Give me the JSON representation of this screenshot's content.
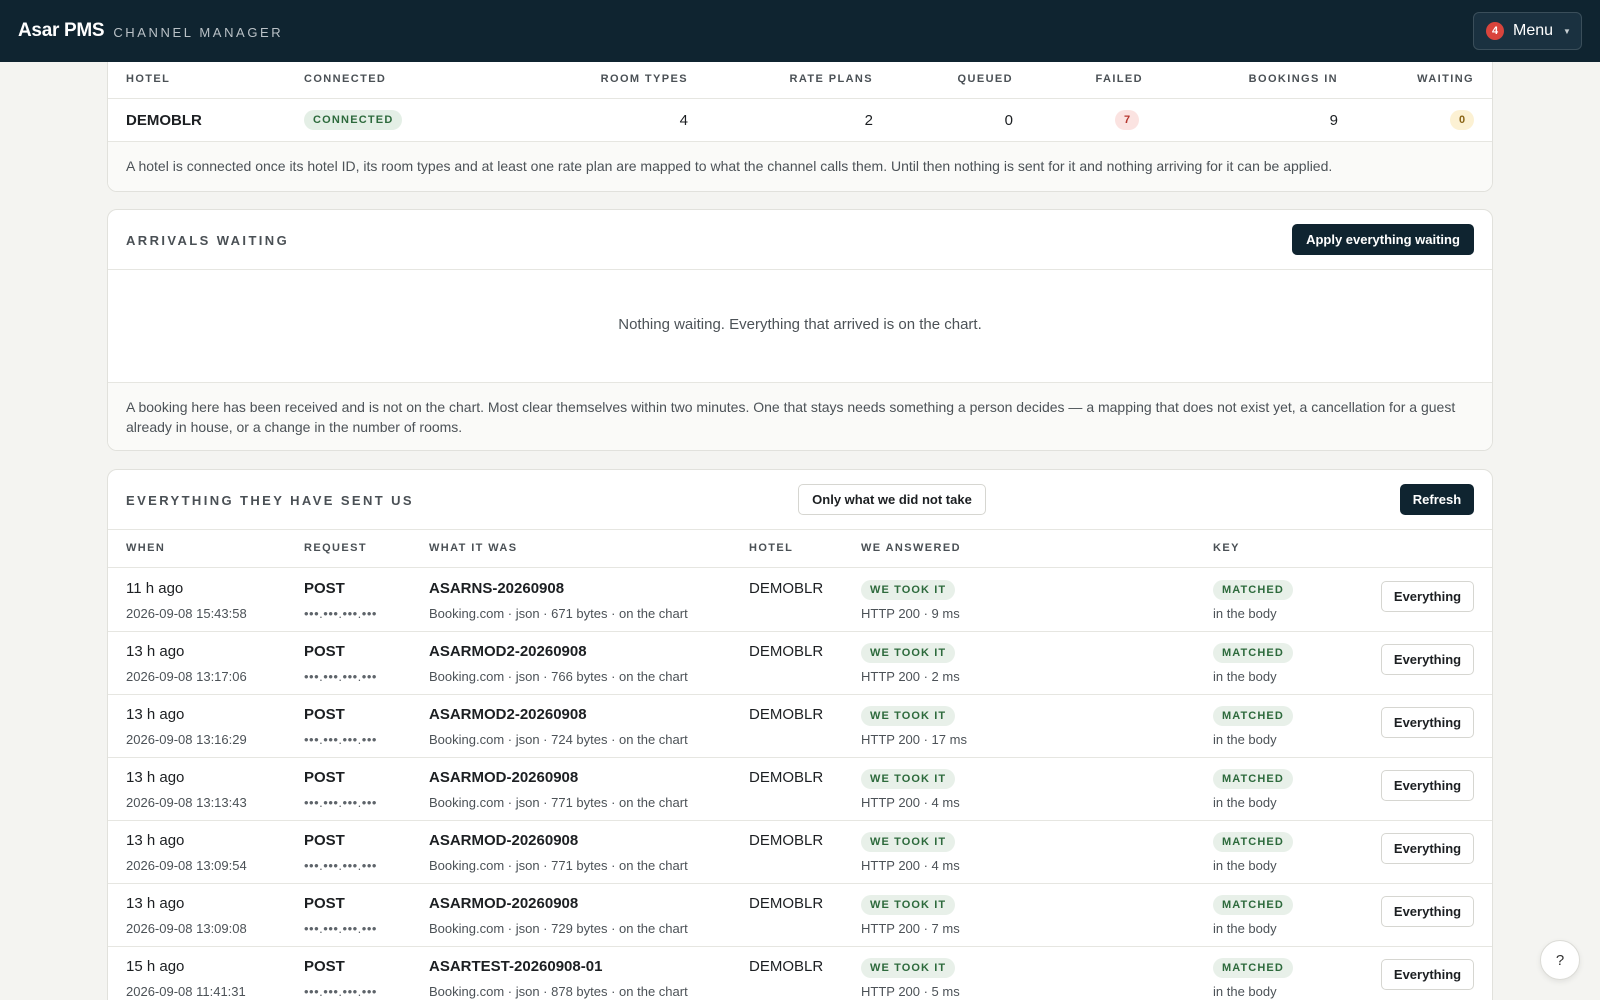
{
  "header": {
    "brand": "Asar PMS",
    "subtitle": "CHANNEL MANAGER",
    "menu_label": "Menu",
    "menu_badge": "4"
  },
  "hotels": {
    "columns": [
      "HOTEL",
      "CONNECTED",
      "ROOM TYPES",
      "RATE PLANS",
      "QUEUED",
      "FAILED",
      "BOOKINGS IN",
      "WAITING"
    ],
    "rows": [
      {
        "hotel": "DEMOBLR",
        "connected": "CONNECTED",
        "room_types": "4",
        "rate_plans": "2",
        "queued": "0",
        "failed": "7",
        "bookings_in": "9",
        "waiting": "0"
      }
    ],
    "note": "A hotel is connected once its hotel ID, its room types and at least one rate plan are mapped to what the channel calls them. Until then nothing is sent for it and nothing arriving for it can be applied."
  },
  "arrivals": {
    "title": "ARRIVALS WAITING",
    "apply_button": "Apply everything waiting",
    "empty": "Nothing waiting. Everything that arrived is on the chart.",
    "note": "A booking here has been received and is not on the chart. Most clear themselves within two minutes. One that stays needs something a person decides — a mapping that does not exist yet, a cancellation for a guest already in house, or a change in the number of rooms."
  },
  "log": {
    "title": "EVERYTHING THEY HAVE SENT US",
    "filter_button": "Only what we did not take",
    "refresh_button": "Refresh",
    "columns": [
      "WHEN",
      "REQUEST",
      "WHAT IT WAS",
      "HOTEL",
      "WE ANSWERED",
      "KEY"
    ],
    "rows": [
      {
        "ago": "11 h ago",
        "ts": "2026-09-08 15:43:58",
        "method": "POST",
        "ip": "•••.•••.•••.•••",
        "ref": "ASARNS-20260908",
        "detail": "Booking.com · json · 671 bytes · on the chart",
        "hotel": "DEMOBLR",
        "answer": "WE TOOK IT",
        "http": "HTTP 200 · 9 ms",
        "key": "MATCHED",
        "key_sub": "in the body",
        "action": "Everything"
      },
      {
        "ago": "13 h ago",
        "ts": "2026-09-08 13:17:06",
        "method": "POST",
        "ip": "•••.•••.•••.•••",
        "ref": "ASARMOD2-20260908",
        "detail": "Booking.com · json · 766 bytes · on the chart",
        "hotel": "DEMOBLR",
        "answer": "WE TOOK IT",
        "http": "HTTP 200 · 2 ms",
        "key": "MATCHED",
        "key_sub": "in the body",
        "action": "Everything"
      },
      {
        "ago": "13 h ago",
        "ts": "2026-09-08 13:16:29",
        "method": "POST",
        "ip": "•••.•••.•••.•••",
        "ref": "ASARMOD2-20260908",
        "detail": "Booking.com · json · 724 bytes · on the chart",
        "hotel": "DEMOBLR",
        "answer": "WE TOOK IT",
        "http": "HTTP 200 · 17 ms",
        "key": "MATCHED",
        "key_sub": "in the body",
        "action": "Everything"
      },
      {
        "ago": "13 h ago",
        "ts": "2026-09-08 13:13:43",
        "method": "POST",
        "ip": "•••.•••.•••.•••",
        "ref": "ASARMOD-20260908",
        "detail": "Booking.com · json · 771 bytes · on the chart",
        "hotel": "DEMOBLR",
        "answer": "WE TOOK IT",
        "http": "HTTP 200 · 4 ms",
        "key": "MATCHED",
        "key_sub": "in the body",
        "action": "Everything"
      },
      {
        "ago": "13 h ago",
        "ts": "2026-09-08 13:09:54",
        "method": "POST",
        "ip": "•••.•••.•••.•••",
        "ref": "ASARMOD-20260908",
        "detail": "Booking.com · json · 771 bytes · on the chart",
        "hotel": "DEMOBLR",
        "answer": "WE TOOK IT",
        "http": "HTTP 200 · 4 ms",
        "key": "MATCHED",
        "key_sub": "in the body",
        "action": "Everything"
      },
      {
        "ago": "13 h ago",
        "ts": "2026-09-08 13:09:08",
        "method": "POST",
        "ip": "•••.•••.•••.•••",
        "ref": "ASARMOD-20260908",
        "detail": "Booking.com · json · 729 bytes · on the chart",
        "hotel": "DEMOBLR",
        "answer": "WE TOOK IT",
        "http": "HTTP 200 · 7 ms",
        "key": "MATCHED",
        "key_sub": "in the body",
        "action": "Everything"
      },
      {
        "ago": "15 h ago",
        "ts": "2026-09-08 11:41:31",
        "method": "POST",
        "ip": "•••.•••.•••.•••",
        "ref": "ASARTEST-20260908-01",
        "detail": "Booking.com · json · 878 bytes · on the chart",
        "hotel": "DEMOBLR",
        "answer": "WE TOOK IT",
        "http": "HTTP 200 · 5 ms",
        "key": "MATCHED",
        "key_sub": "in the body",
        "action": "Everything"
      }
    ]
  },
  "help_label": "?"
}
